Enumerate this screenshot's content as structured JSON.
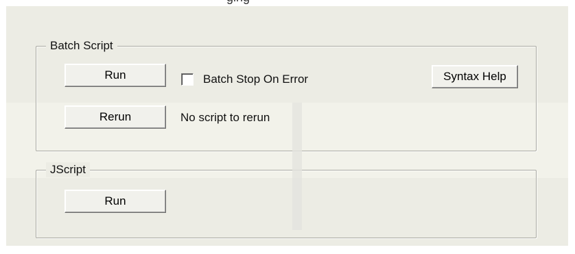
{
  "window": {
    "title_fragment": "ging"
  },
  "batch_script": {
    "legend": "Batch Script",
    "run_label": "Run",
    "stop_on_error_label": "Batch Stop On Error",
    "stop_on_error_checked": false,
    "syntax_help_label": "Syntax Help",
    "rerun_label": "Rerun",
    "rerun_status": "No script to rerun"
  },
  "jscript": {
    "legend": "JScript",
    "run_label": "Run"
  }
}
